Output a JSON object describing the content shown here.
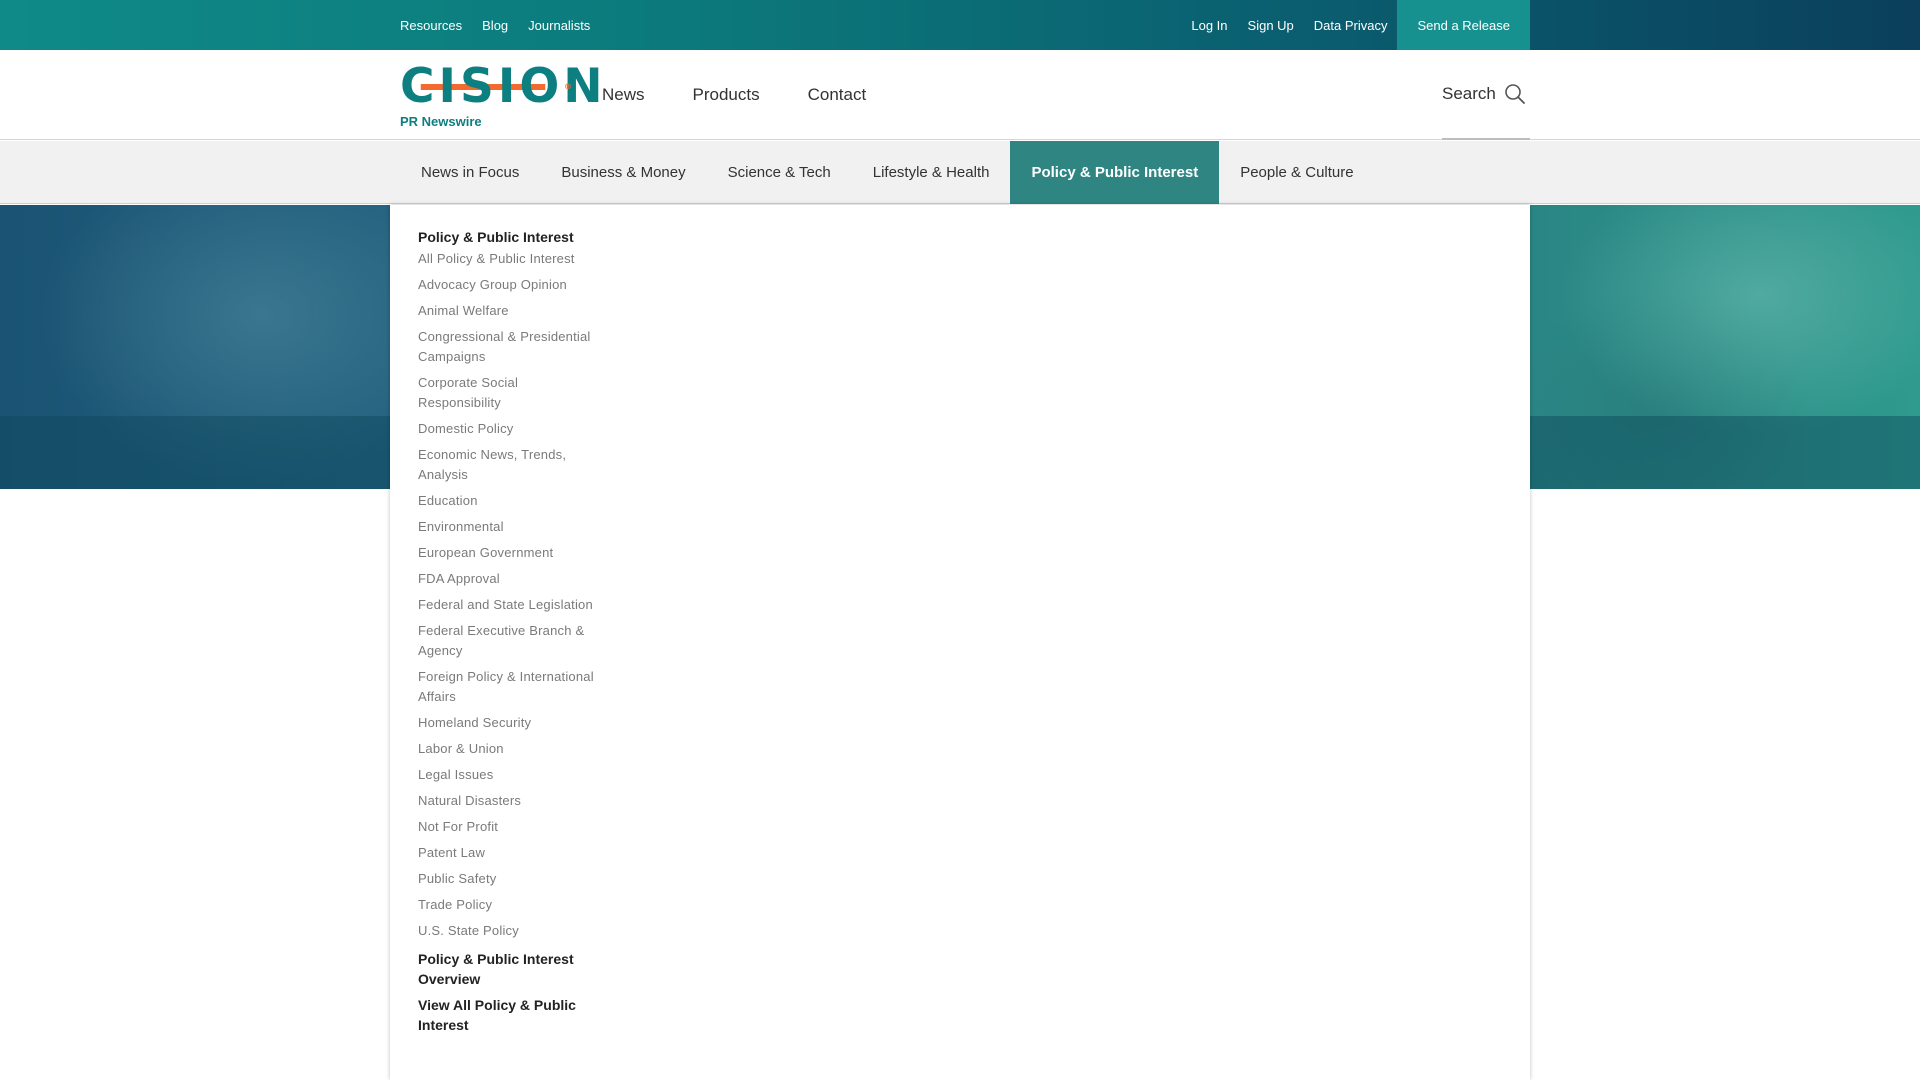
{
  "topbar": {
    "left_links": [
      "Resources",
      "Blog",
      "Journalists"
    ],
    "right_links": [
      "Log In",
      "Sign Up",
      "Data Privacy"
    ],
    "send_release": "Send a Release"
  },
  "logo": {
    "wordmark": "CISION",
    "sub": "PR Newswire",
    "reg": "®"
  },
  "mainnav": [
    "News",
    "Products",
    "Contact"
  ],
  "search": {
    "label": "Search"
  },
  "categories": [
    {
      "label": "News in Focus",
      "active": false
    },
    {
      "label": "Business & Money",
      "active": false
    },
    {
      "label": "Science & Tech",
      "active": false
    },
    {
      "label": "Lifestyle & Health",
      "active": false
    },
    {
      "label": "Policy & Public Interest",
      "active": true
    },
    {
      "label": "People & Culture",
      "active": false
    }
  ],
  "dropdown": {
    "heading": "Policy & Public Interest",
    "items": [
      "All Policy & Public Interest",
      "Advocacy Group Opinion",
      "Animal Welfare",
      "Congressional & Presidential Campaigns",
      "Corporate Social Responsibility",
      "Domestic Policy",
      "Economic News, Trends, Analysis",
      "Education",
      "Environmental",
      "European Government",
      "FDA Approval",
      "Federal and State Legislation",
      "Federal Executive Branch & Agency",
      "Foreign Policy & International Affairs",
      "Homeland Security",
      "Labor & Union",
      "Legal Issues",
      "Natural Disasters",
      "Not For Profit",
      "Patent Law",
      "Public Safety",
      "Trade Policy",
      "U.S. State Policy"
    ],
    "overview": "Policy & Public Interest Overview",
    "view_all": "View All Policy & Public Interest"
  },
  "colors": {
    "brand_teal": "#0d7f80",
    "brand_orange": "#f26a2e",
    "active_tab": "#2e8582"
  }
}
